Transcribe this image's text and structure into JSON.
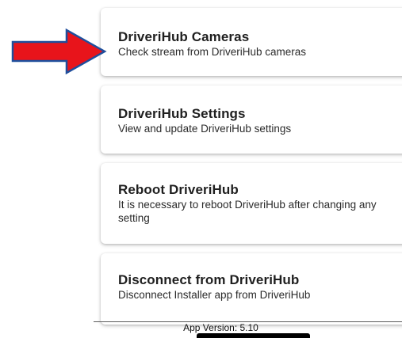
{
  "menu": {
    "items": [
      {
        "title": "DriveriHub Cameras",
        "subtitle": "Check stream from DriveriHub cameras"
      },
      {
        "title": "DriveriHub Settings",
        "subtitle": "View and update DriveriHub settings"
      },
      {
        "title": "Reboot DriveriHub",
        "subtitle": "It is necessary to reboot DriveriHub after changing any setting"
      },
      {
        "title": "Disconnect from DriveriHub",
        "subtitle": "Disconnect Installer app from DriveriHub"
      }
    ]
  },
  "footer": {
    "version_text": "App Version: 5.10"
  },
  "colors": {
    "arrow_fill": "#e8141b",
    "arrow_stroke": "#1f4e9c",
    "card_background": "#ffffff",
    "title_text": "#1f1f1f"
  }
}
